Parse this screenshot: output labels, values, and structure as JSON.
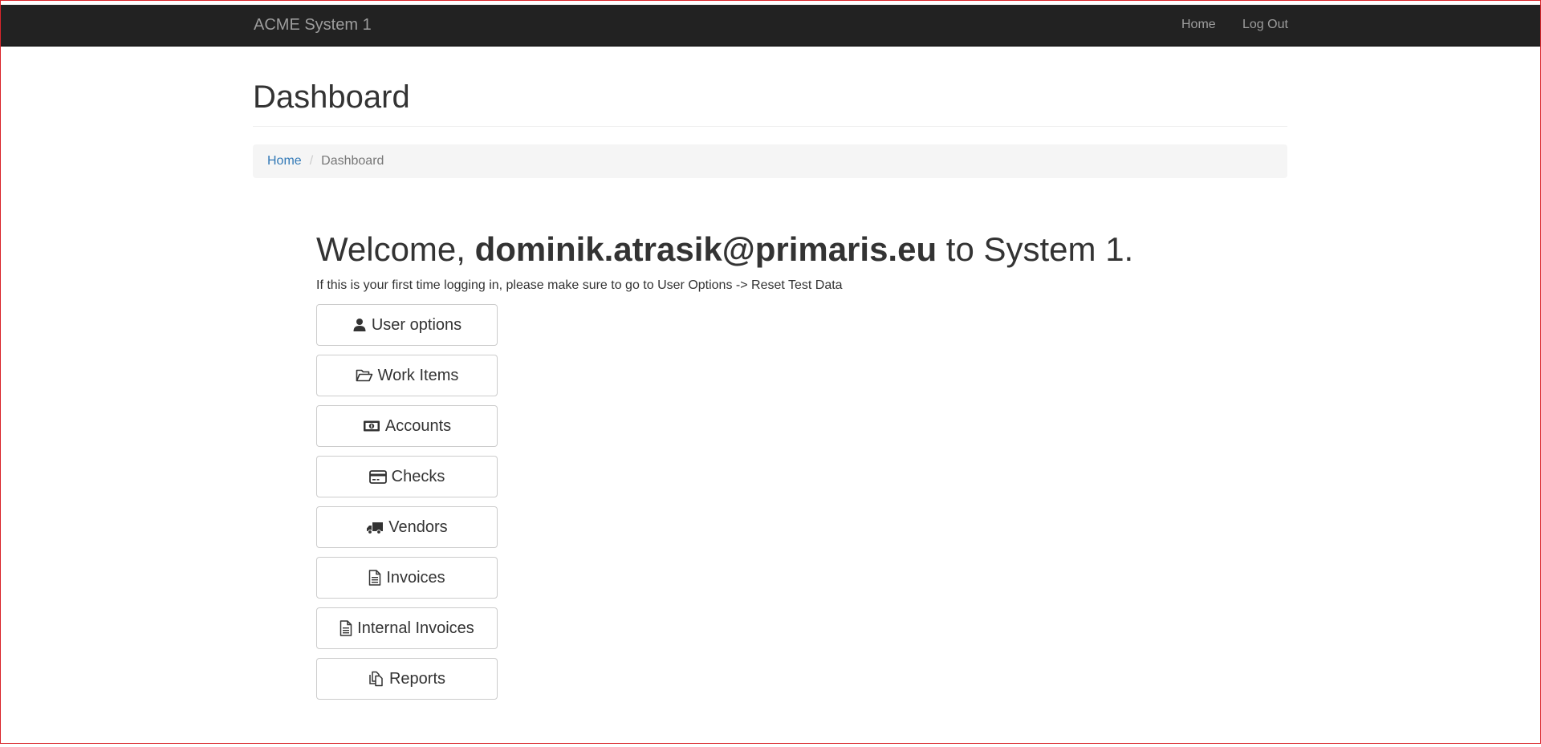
{
  "navbar": {
    "brand": "ACME System 1",
    "links": {
      "home": "Home",
      "logout": "Log Out"
    }
  },
  "page": {
    "title": "Dashboard"
  },
  "breadcrumb": {
    "home": "Home",
    "separator": "/",
    "current": "Dashboard"
  },
  "welcome": {
    "prefix": "Welcome,",
    "user": "dominik.atrasik@primaris.eu",
    "suffix": "to System 1."
  },
  "hint": "If this is your first time logging in, please make sure to go to User Options -> Reset Test Data",
  "buttons": [
    {
      "label": "User options",
      "icon": "user-icon"
    },
    {
      "label": "Work Items",
      "icon": "folder-open-icon"
    },
    {
      "label": "Accounts",
      "icon": "money-icon"
    },
    {
      "label": "Checks",
      "icon": "credit-card-icon"
    },
    {
      "label": "Vendors",
      "icon": "truck-icon"
    },
    {
      "label": "Invoices",
      "icon": "file-text-icon"
    },
    {
      "label": "Internal Invoices",
      "icon": "file-text-icon"
    },
    {
      "label": "Reports",
      "icon": "copy-icon"
    }
  ],
  "colors": {
    "navbar_bg": "#222222",
    "nav_text": "#9d9d9d",
    "link": "#337ab7",
    "breadcrumb_bg": "#f5f5f5",
    "frame": "#d9252b"
  }
}
